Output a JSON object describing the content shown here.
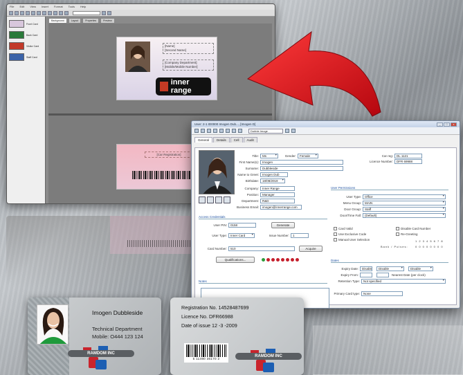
{
  "designer": {
    "menus": [
      "File",
      "Edit",
      "View",
      "Insert",
      "Format",
      "Tools",
      "Help"
    ],
    "thumbs": [
      {
        "label": "Front Card",
        "color": "#d8c7dc"
      },
      {
        "label": "Back Card",
        "color": "#2a7a3a"
      },
      {
        "label": "Visitor Card",
        "color": "#c23a2a"
      },
      {
        "label": "Staff Card",
        "color": "#3b63a8"
      }
    ],
    "tabs": [
      "Background",
      "Layout",
      "Properties",
      "Preview"
    ],
    "front": {
      "name_lines": "[Name]\n[Second Name]",
      "dept_lines": "[Company Department]\n[Mobile/Mobile Number]",
      "logo_text": "inner range"
    },
    "back": {
      "reg_field": "[Car Registration]"
    }
  },
  "dialog": {
    "title": "User: 2-1 ID0000 Imogen Dub..., [Imogen D]",
    "win_buttons": [
      "_",
      "□",
      "x"
    ],
    "search_value": "Dubble Imoge",
    "tabs": [
      "General",
      "Details",
      "Cell",
      "Audit"
    ],
    "fields": {
      "title_label": "Title:",
      "title_value": "Ms",
      "gender_label": "Gender:",
      "gender_value": "Female",
      "card_no_label": "Car reg:",
      "card_no_value": "DL 1121",
      "licence_label": "Licence Number:",
      "licence_value": "DFR 69988",
      "first_label": "First Name(s):",
      "first_value": "Imogen",
      "surname_label": "Surname:",
      "surname_value": "Dubbleside",
      "known_label": "Name to Greet:",
      "known_value": "Imogen Dub",
      "birthdate_label": "Birthdate:",
      "birthdate_value": "18/08/2019",
      "company_label": "Company:",
      "company_value": "Inner Range",
      "position_label": "Position:",
      "position_value": "Manager",
      "department_label": "Department:",
      "department_value": "R&D",
      "email_label": "Business Email:",
      "email_value": "imogen@innerrange.com"
    },
    "user_perm_header": "User Permissions",
    "perms": [
      {
        "label": "User Type:",
        "value": "Office"
      },
      {
        "label": "Menu Group:",
        "value": "MAIN"
      },
      {
        "label": "Door Group:",
        "value": "Staff"
      },
      {
        "label": "Door/Time Fall:",
        "value": "(Default)"
      }
    ],
    "access_header": "Access Credentials",
    "user_pin_label": "User PIN:",
    "user_pin_value": "0158",
    "generate_label": "Generate",
    "user_type_label": "User Type:",
    "user_type_value": "Inner Card",
    "issue_label": "Issue Number:",
    "issue_value": "1",
    "card_number_label": "Card Number:",
    "card_number_value": "510",
    "acquire_label": "Acquire",
    "qualifications_label": "Qualifications...",
    "checks_left": [
      "Card Valid",
      "Use Exclusive Code",
      "Manual User Selection"
    ],
    "checks_right": [
      "Disable Card Number",
      "Re-Greeting"
    ],
    "bits_label": "1 2 3 4 5 6 7 8",
    "bits_row_label": "Bank / Pulses:",
    "bits_values": "0 0 0 0 0 0 0 0",
    "notes_header": "Notes",
    "dates_header": "Dates",
    "expiry_label": "Expiry Date:",
    "expiry_value": "Disable",
    "expiry_time": "Disable",
    "expiry_from_label": "Expiry From:",
    "expiry_note": "Nearest Date (per clock)",
    "remote_label": "Retention Type:",
    "remote_value": "Not specified",
    "primary_label": "Primary Card type:",
    "primary_value": "None"
  },
  "card1": {
    "name": "Imogen Dubbleside",
    "department": "Technical Department",
    "mobile": "Mobile: O444 123 124",
    "brand": "RAMDOM INC"
  },
  "card2": {
    "registration": "Registration No. 14528487699",
    "licence": "Licence No. DFR66988",
    "issue": "Date of issue  12 -3 -2009",
    "barcode_number": "5 11490 36170 2",
    "brand": "RAMDOM INC"
  },
  "colors": {
    "arrow": "#d5141c",
    "dialog_section": "#1b4fa0",
    "brand_red": "#c9242c",
    "brand_blue": "#1d5fb3"
  }
}
